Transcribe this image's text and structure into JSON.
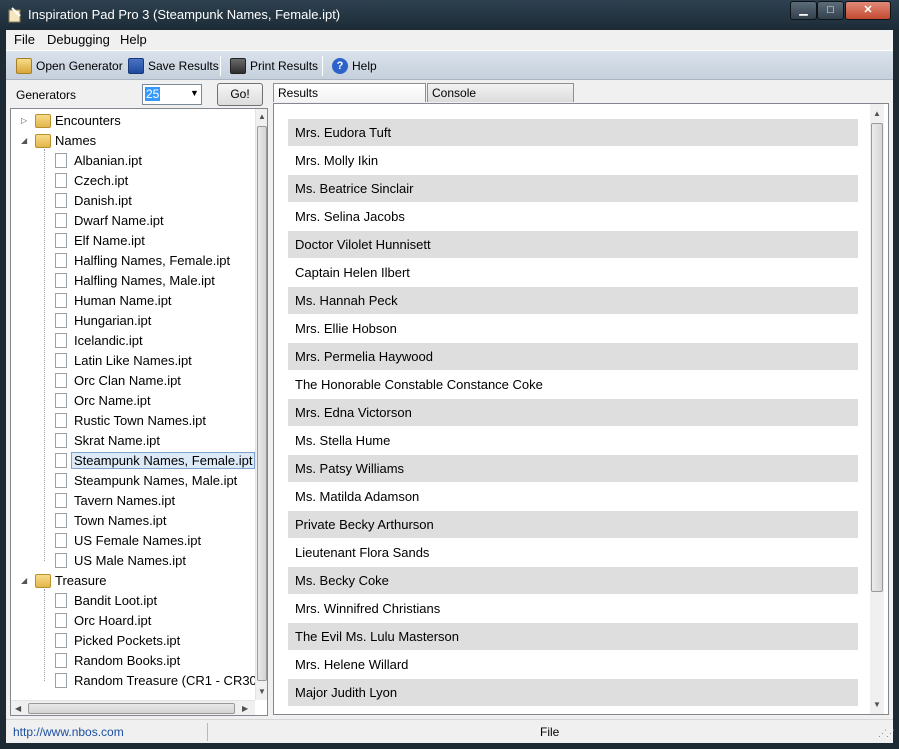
{
  "window": {
    "title": "Inspiration Pad Pro 3  (Steampunk Names, Female.ipt)",
    "minimize": "▁",
    "maximize": "□",
    "close": "✕"
  },
  "menu": [
    "File",
    "Debugging",
    "Help"
  ],
  "toolbar": {
    "open_generator": "Open Generator",
    "save_results": "Save Results",
    "print_results": "Print Results",
    "help": "Help"
  },
  "generators": {
    "label": "Generators",
    "count": "25",
    "go_label": "Go!"
  },
  "tree": {
    "folders": [
      {
        "label": "Encounters",
        "expanded": false,
        "items": []
      },
      {
        "label": "Names",
        "expanded": true,
        "items": [
          "Albanian.ipt",
          "Czech.ipt",
          "Danish.ipt",
          "Dwarf Name.ipt",
          "Elf Name.ipt",
          "Halfling Names, Female.ipt",
          "Halfling Names, Male.ipt",
          "Human Name.ipt",
          "Hungarian.ipt",
          "Icelandic.ipt",
          "Latin Like Names.ipt",
          "Orc Clan Name.ipt",
          "Orc Name.ipt",
          "Rustic Town Names.ipt",
          "Skrat Name.ipt",
          "Steampunk Names, Female.ipt",
          "Steampunk Names, Male.ipt",
          "Tavern Names.ipt",
          "Town Names.ipt",
          "US Female Names.ipt",
          "US Male Names.ipt"
        ]
      },
      {
        "label": "Treasure",
        "expanded": true,
        "items": [
          "Bandit Loot.ipt",
          "Orc Hoard.ipt",
          "Picked Pockets.ipt",
          "Random Books.ipt",
          "Random Treasure (CR1 - CR30"
        ]
      }
    ],
    "selected": "Steampunk Names, Female.ipt"
  },
  "tabs": [
    "Results",
    "Console"
  ],
  "results": [
    "Mrs. Eudora Tuft",
    "Mrs. Molly Ikin",
    "Ms. Beatrice Sinclair",
    "Mrs. Selina Jacobs",
    "Doctor Vilolet Hunnisett",
    "Captain Helen Ilbert",
    "Ms. Hannah Peck",
    "Mrs. Ellie Hobson",
    "Mrs. Permelia Haywood",
    "The Honorable Constable Constance Coke",
    "Mrs. Edna Victorson",
    "Ms. Stella Hume",
    "Ms. Patsy Williams",
    "Ms. Matilda Adamson",
    "Private Becky Arthurson",
    "Lieutenant Flora Sands",
    "Ms. Becky Coke",
    "Mrs. Winnifred Christians",
    "The Evil Ms. Lulu Masterson",
    "Mrs. Helene Willard",
    "Major Judith Lyon"
  ],
  "status": {
    "link": "http://www.nbos.com",
    "text": "File"
  },
  "colors": {
    "titlebar": "#1c2b36",
    "selection": "#3399ff",
    "row_alt": "#dedede",
    "link": "#1a4fa0"
  }
}
